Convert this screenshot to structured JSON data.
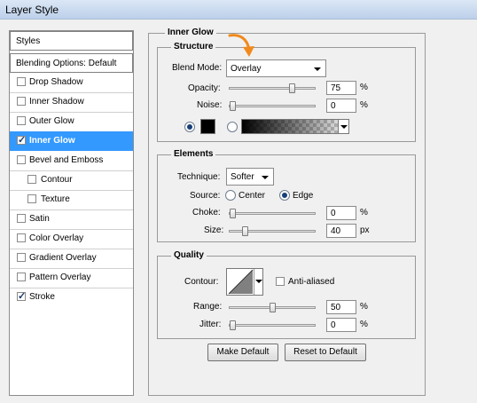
{
  "window": {
    "title": "Layer Style"
  },
  "styles_list": {
    "header": "Styles",
    "blending_options": "Blending Options: Default",
    "items": [
      {
        "label": "Drop Shadow",
        "checked": false
      },
      {
        "label": "Inner Shadow",
        "checked": false
      },
      {
        "label": "Outer Glow",
        "checked": false
      },
      {
        "label": "Inner Glow",
        "checked": true,
        "selected": true
      },
      {
        "label": "Bevel and Emboss",
        "checked": false
      },
      {
        "label": "Contour",
        "checked": false,
        "sub": true
      },
      {
        "label": "Texture",
        "checked": false,
        "sub": true
      },
      {
        "label": "Satin",
        "checked": false
      },
      {
        "label": "Color Overlay",
        "checked": false
      },
      {
        "label": "Gradient Overlay",
        "checked": false
      },
      {
        "label": "Pattern Overlay",
        "checked": false
      },
      {
        "label": "Stroke",
        "checked": true
      }
    ]
  },
  "inner_glow": {
    "title": "Inner Glow",
    "structure": {
      "title": "Structure",
      "blend_mode_label": "Blend Mode:",
      "blend_mode": "Overlay",
      "opacity_label": "Opacity:",
      "opacity": "75",
      "opacity_unit": "%",
      "opacity_value": 75,
      "noise_label": "Noise:",
      "noise": "0",
      "noise_unit": "%",
      "noise_value": 0,
      "color_mode": "solid",
      "glow_color": "#000000"
    },
    "elements": {
      "title": "Elements",
      "technique_label": "Technique:",
      "technique": "Softer",
      "source_label": "Source:",
      "source_center": "Center",
      "source_edge": "Edge",
      "source_selected": "Edge",
      "choke_label": "Choke:",
      "choke": "0",
      "choke_unit": "%",
      "choke_value": 0,
      "size_label": "Size:",
      "size": "40",
      "size_unit": "px",
      "size_value": 40
    },
    "quality": {
      "title": "Quality",
      "contour_label": "Contour:",
      "anti_aliased_label": "Anti-aliased",
      "anti_aliased": false,
      "range_label": "Range:",
      "range": "50",
      "range_unit": "%",
      "range_value": 50,
      "jitter_label": "Jitter:",
      "jitter": "0",
      "jitter_unit": "%",
      "jitter_value": 0
    },
    "buttons": {
      "make_default": "Make Default",
      "reset_default": "Reset to Default"
    }
  },
  "colors": {
    "selection": "#3399ff",
    "arrow_annotation": "#f08a1c"
  }
}
